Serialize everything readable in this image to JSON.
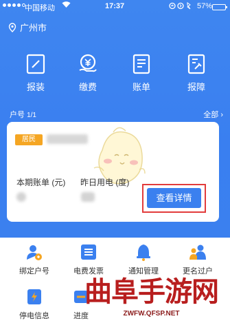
{
  "statusbar": {
    "carrier": "中国移动",
    "time": "17:37",
    "battery_pct": "57%",
    "battery_level": 0.57,
    "signal_bars": 4
  },
  "location": {
    "city": "广州市"
  },
  "actions": [
    {
      "label": "报装",
      "icon": "edit-doc-icon"
    },
    {
      "label": "缴费",
      "icon": "yen-coin-icon"
    },
    {
      "label": "账单",
      "icon": "bill-icon"
    },
    {
      "label": "报障",
      "icon": "repair-doc-icon"
    }
  ],
  "account": {
    "label": "户号",
    "page": "1/1",
    "all_label": "全部 ›",
    "tag": "居民",
    "bill_label": "本期账单 (元)",
    "elec_label": "昨日用电 (度)",
    "detail_button": "查看详情"
  },
  "services": [
    {
      "label": "绑定户号",
      "icon": "user-bind-icon"
    },
    {
      "label": "电费发票",
      "icon": "invoice-icon"
    },
    {
      "label": "通知管理",
      "icon": "bell-icon"
    },
    {
      "label": "更名过户",
      "icon": "users-transfer-icon"
    },
    {
      "label": "停电信息",
      "icon": "power-outage-icon"
    },
    {
      "label": "进度",
      "icon": "progress-icon"
    }
  ],
  "watermark": {
    "title": "曲阜手游网",
    "url": "ZWFW.QFSP.NET"
  },
  "colors": {
    "primary": "#3b80ef",
    "tag": "#f5a623",
    "highlight": "#e23b3b",
    "watermark": "#b81e1e"
  }
}
